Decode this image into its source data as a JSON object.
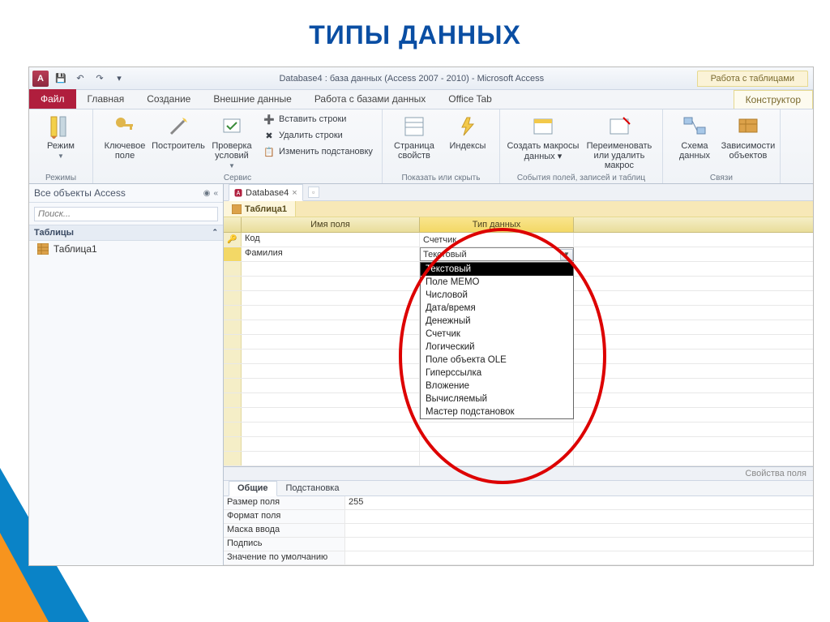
{
  "page_heading": "ТИПЫ ДАННЫХ",
  "app": {
    "logo_letter": "A",
    "title": "Database4 : база данных (Access 2007 - 2010)  -  Microsoft Access",
    "context_group": "Работа с таблицами"
  },
  "qat": {
    "save": "💾",
    "undo": "↶",
    "redo": "↷",
    "down": "▾"
  },
  "tabs": {
    "file": "Файл",
    "home": "Главная",
    "create": "Создание",
    "external": "Внешние данные",
    "dbtools": "Работа с базами данных",
    "office": "Office Tab",
    "design": "Конструктор"
  },
  "ribbon": {
    "views": {
      "btn": "Режим",
      "label": "Режимы"
    },
    "tools": {
      "primary_key": "Ключевое поле",
      "builder": "Построитель",
      "validation": "Проверка условий",
      "insert_rows": "Вставить строки",
      "delete_rows": "Удалить строки",
      "modify_lookups": "Изменить подстановку",
      "label": "Сервис"
    },
    "showhide": {
      "property_sheet": "Страница свойств",
      "indexes": "Индексы",
      "label": "Показать или скрыть"
    },
    "events": {
      "create_macros": "Создать макросы данных ▾",
      "rename_delete": "Переименовать или удалить макрос",
      "label": "События полей, записей и таблиц"
    },
    "relations": {
      "relationships": "Схема данных",
      "dependencies": "Зависимости объектов",
      "label": "Связи"
    }
  },
  "nav": {
    "header": "Все объекты Access",
    "search_placeholder": "Поиск...",
    "category": "Таблицы",
    "item1": "Таблица1"
  },
  "doc": {
    "tab_name": "Database4",
    "obj_tab": "Таблица1"
  },
  "design": {
    "col_field": "Имя поля",
    "col_type": "Тип данных",
    "rows": [
      {
        "name": "Код",
        "type": "Счетчик",
        "pk": true
      },
      {
        "name": "Фамилия",
        "type": "Текстовый",
        "editing": true
      }
    ],
    "dropdown": [
      "Текстовый",
      "Поле МЕМО",
      "Числовой",
      "Дата/время",
      "Денежный",
      "Счетчик",
      "Логический",
      "Поле объекта OLE",
      "Гиперссылка",
      "Вложение",
      "Вычисляемый",
      "Мастер подстановок"
    ],
    "dropdown_selected": 0
  },
  "properties": {
    "header": "Свойства поля",
    "tab_general": "Общие",
    "tab_lookup": "Подстановка",
    "rows": [
      {
        "name": "Размер поля",
        "value": "255"
      },
      {
        "name": "Формат поля",
        "value": ""
      },
      {
        "name": "Маска ввода",
        "value": ""
      },
      {
        "name": "Подпись",
        "value": ""
      },
      {
        "name": "Значение по умолчанию",
        "value": ""
      }
    ]
  }
}
